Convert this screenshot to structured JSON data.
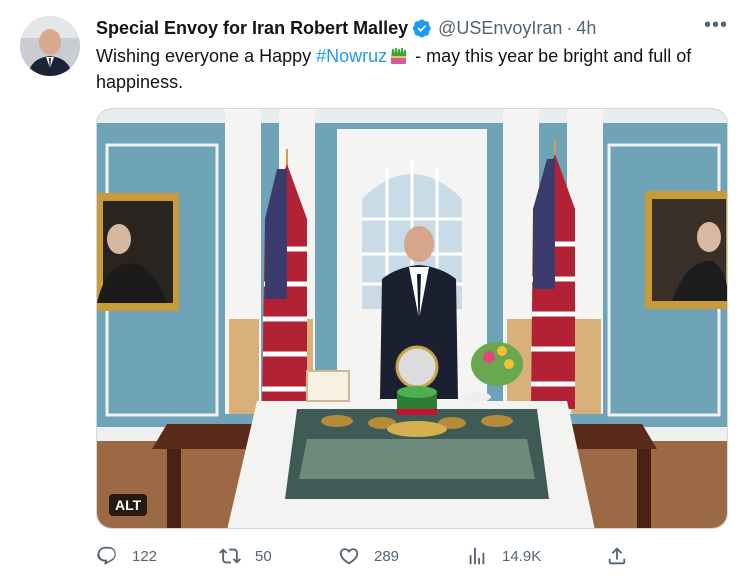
{
  "tweet": {
    "display_name": "Special Envoy for Iran Robert Malley",
    "handle": "@USEnvoyIran",
    "separator": "·",
    "time": "4h",
    "more_icon": "more-dots-icon",
    "text_before": "Wishing everyone a Happy ",
    "hashtag": "#Nowruz",
    "text_after": " - may this year be bright and full of happiness.",
    "media_alt_badge": "ALT"
  },
  "actions": {
    "replies": "122",
    "retweets": "50",
    "likes": "289",
    "views": "14.9K"
  },
  "colors": {
    "accent": "#1d9bf0",
    "secondary_text": "#536471",
    "verified": "#1d9bf0"
  }
}
